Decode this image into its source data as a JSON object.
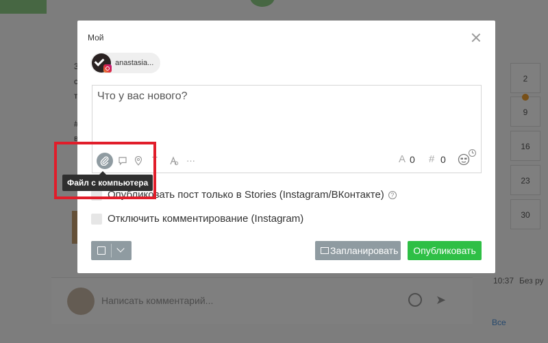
{
  "modal": {
    "title": "Мой",
    "account_name": "anastasia...",
    "editor_placeholder": "Что у вас нового?",
    "counters": {
      "char_symbol": "A",
      "char_count": "0",
      "hashtag_symbol": "#",
      "hashtag_count": "0"
    },
    "toolbar_more": "···",
    "toolbar_text": "T",
    "tooltip": "Файл с компьютера",
    "options": {
      "stories_only": "Опубликовать пост только в Stories (Instagram/ВКонтакте)",
      "disable_comments": "Отключить комментирование (Instagram)",
      "help": "?"
    },
    "buttons": {
      "schedule": "Запланировать",
      "publish": "Опубликовать"
    }
  },
  "background": {
    "left_text": [
      "3",
      "с",
      "т",
      "#",
      "в"
    ],
    "calendar": [
      "2",
      "9",
      "16",
      "23",
      "30"
    ],
    "time": "10:37",
    "time_extra": "Без ру",
    "comment_placeholder": "Написать комментарий...",
    "all_link": "Все"
  },
  "colors": {
    "accent_green": "#2ebf45",
    "button_gray": "#8f9ba1",
    "highlight_red": "#e11d2a"
  }
}
